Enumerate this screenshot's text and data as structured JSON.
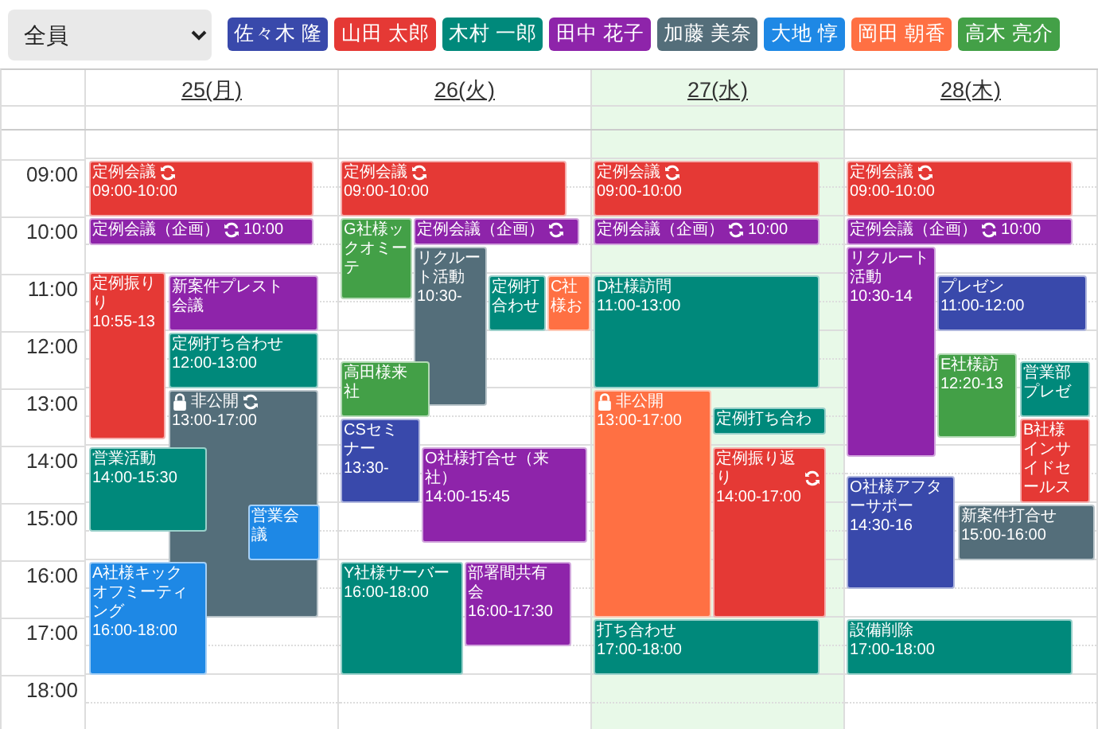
{
  "filter": {
    "value": "全員"
  },
  "members": [
    {
      "name": "佐々木 隆",
      "color": "#3949ab"
    },
    {
      "name": "山田 太郎",
      "color": "#e53935"
    },
    {
      "name": "木村 一郎",
      "color": "#00897b"
    },
    {
      "name": "田中 花子",
      "color": "#8e24aa"
    },
    {
      "name": "加藤 美奈",
      "color": "#546e7a"
    },
    {
      "name": "大地 惇",
      "color": "#1e88e5"
    },
    {
      "name": "岡田 朝香",
      "color": "#ff7043"
    },
    {
      "name": "高木 亮介",
      "color": "#43a047"
    }
  ],
  "times": [
    "09:00",
    "10:00",
    "11:00",
    "12:00",
    "13:00",
    "14:00",
    "15:00",
    "16:00",
    "17:00",
    "18:00"
  ],
  "days": [
    {
      "label": "25(月)",
      "today": false,
      "events": [
        {
          "kind": "block",
          "title": "定例会議",
          "time": "09:00-10:00",
          "recurring": true,
          "private": false,
          "color": "#e53935"
        },
        {
          "kind": "compact",
          "title": "定例会議（企画）",
          "time": "10:00",
          "recurring": true,
          "private": false,
          "color": "#8e24aa"
        },
        {
          "kind": "block",
          "title": "定例振りり",
          "time": "10:55-13",
          "recurring": false,
          "private": false,
          "color": "#e53935"
        },
        {
          "kind": "block",
          "title": "新案件プレスト会議",
          "recurring": false,
          "private": false,
          "color": "#8e24aa"
        },
        {
          "kind": "block",
          "title": "定例打ち合わせ",
          "time": "12:00-13:00",
          "recurring": false,
          "private": false,
          "color": "#00897b"
        },
        {
          "kind": "block",
          "title": "非公開",
          "time": "13:00-17:00",
          "recurring": true,
          "private": true,
          "color": "#546e7a"
        },
        {
          "kind": "block",
          "title": "営業活動",
          "time": "14:00-15:30",
          "recurring": false,
          "private": false,
          "color": "#00897b"
        },
        {
          "kind": "block",
          "title": "営業会議",
          "recurring": false,
          "private": false,
          "color": "#1e88e5"
        },
        {
          "kind": "block",
          "title": "A社様キックオフミーティング",
          "time": "16:00-18:00",
          "recurring": false,
          "private": false,
          "color": "#1e88e5"
        }
      ]
    },
    {
      "label": "26(火)",
      "today": false,
      "events": [
        {
          "kind": "block",
          "title": "定例会議",
          "time": "09:00-10:00",
          "recurring": true,
          "private": false,
          "color": "#e53935"
        },
        {
          "kind": "block",
          "title": "G社様ックオミーテ",
          "recurring": false,
          "private": false,
          "color": "#43a047"
        },
        {
          "kind": "compact",
          "title": "定例会議（企画）",
          "recurring": true,
          "private": false,
          "color": "#8e24aa"
        },
        {
          "kind": "block",
          "title": "リクルート活動",
          "time": "10:30-",
          "recurring": false,
          "private": false,
          "color": "#546e7a"
        },
        {
          "kind": "block",
          "title": "定例打合わせ",
          "recurring": false,
          "private": false,
          "color": "#00897b"
        },
        {
          "kind": "block",
          "title": "C社様お",
          "recurring": false,
          "private": false,
          "color": "#ff7043"
        },
        {
          "kind": "block",
          "title": "高田様来社",
          "recurring": false,
          "private": false,
          "color": "#43a047"
        },
        {
          "kind": "block",
          "title": "CSセミナー",
          "time": "13:30-",
          "recurring": false,
          "private": false,
          "color": "#3949ab"
        },
        {
          "kind": "block",
          "title": "O社様打合せ（来社）",
          "time": "14:00-15:45",
          "recurring": false,
          "private": false,
          "color": "#8e24aa"
        },
        {
          "kind": "block",
          "title": "Y社様サーバー",
          "time": "16:00-18:00",
          "recurring": false,
          "private": false,
          "color": "#00897b"
        },
        {
          "kind": "block",
          "title": "部署間共有会",
          "time": "16:00-17:30",
          "recurring": false,
          "private": false,
          "color": "#8e24aa"
        }
      ]
    },
    {
      "label": "27(水)",
      "today": true,
      "events": [
        {
          "kind": "block",
          "title": "定例会議",
          "time": "09:00-10:00",
          "recurring": true,
          "private": false,
          "color": "#e53935"
        },
        {
          "kind": "compact",
          "title": "定例会議（企画）",
          "time": "10:00",
          "recurring": true,
          "private": false,
          "color": "#8e24aa"
        },
        {
          "kind": "block",
          "title": "D社様訪問",
          "time": "11:00-13:00",
          "recurring": false,
          "private": false,
          "color": "#00897b"
        },
        {
          "kind": "block",
          "title": "非公開",
          "time": "13:00-17:00",
          "recurring": false,
          "private": true,
          "color": "#ff7043"
        },
        {
          "kind": "block",
          "title": "定例打ち合わ",
          "recurring": false,
          "private": false,
          "color": "#00897b"
        },
        {
          "kind": "block",
          "title": "定例振り返り",
          "time": "14:00-17:00",
          "recurring": true,
          "private": false,
          "color": "#e53935"
        },
        {
          "kind": "block",
          "title": "打ち合わせ",
          "time": "17:00-18:00",
          "recurring": false,
          "private": false,
          "color": "#00897b"
        }
      ]
    },
    {
      "label": "28(木)",
      "today": false,
      "events": [
        {
          "kind": "block",
          "title": "定例会議",
          "time": "09:00-10:00",
          "recurring": true,
          "private": false,
          "color": "#e53935"
        },
        {
          "kind": "compact",
          "title": "定例会議（企画）",
          "time": "10:00",
          "recurring": true,
          "private": false,
          "color": "#8e24aa"
        },
        {
          "kind": "block",
          "title": "リクルート活動",
          "time": "10:30-14",
          "recurring": false,
          "private": false,
          "color": "#8e24aa"
        },
        {
          "kind": "block",
          "title": "プレゼン",
          "time": "11:00-12:00",
          "recurring": false,
          "private": false,
          "color": "#3949ab"
        },
        {
          "kind": "block",
          "title": "E社様訪",
          "time": "12:20-13",
          "recurring": false,
          "private": false,
          "color": "#43a047"
        },
        {
          "kind": "block",
          "title": "営業部プレゼ",
          "recurring": false,
          "private": false,
          "color": "#00897b"
        },
        {
          "kind": "block",
          "title": "B社様インサイドセールス",
          "recurring": false,
          "private": false,
          "color": "#e53935"
        },
        {
          "kind": "block",
          "title": "O社様アフターサポー",
          "time": "14:30-16",
          "recurring": false,
          "private": false,
          "color": "#3949ab"
        },
        {
          "kind": "block",
          "title": "新案件打合せ",
          "time": "15:00-16:00",
          "recurring": false,
          "private": false,
          "color": "#546e7a"
        },
        {
          "kind": "block",
          "title": "設備削除",
          "time": "17:00-18:00",
          "recurring": false,
          "private": false,
          "color": "#00897b"
        }
      ]
    }
  ]
}
